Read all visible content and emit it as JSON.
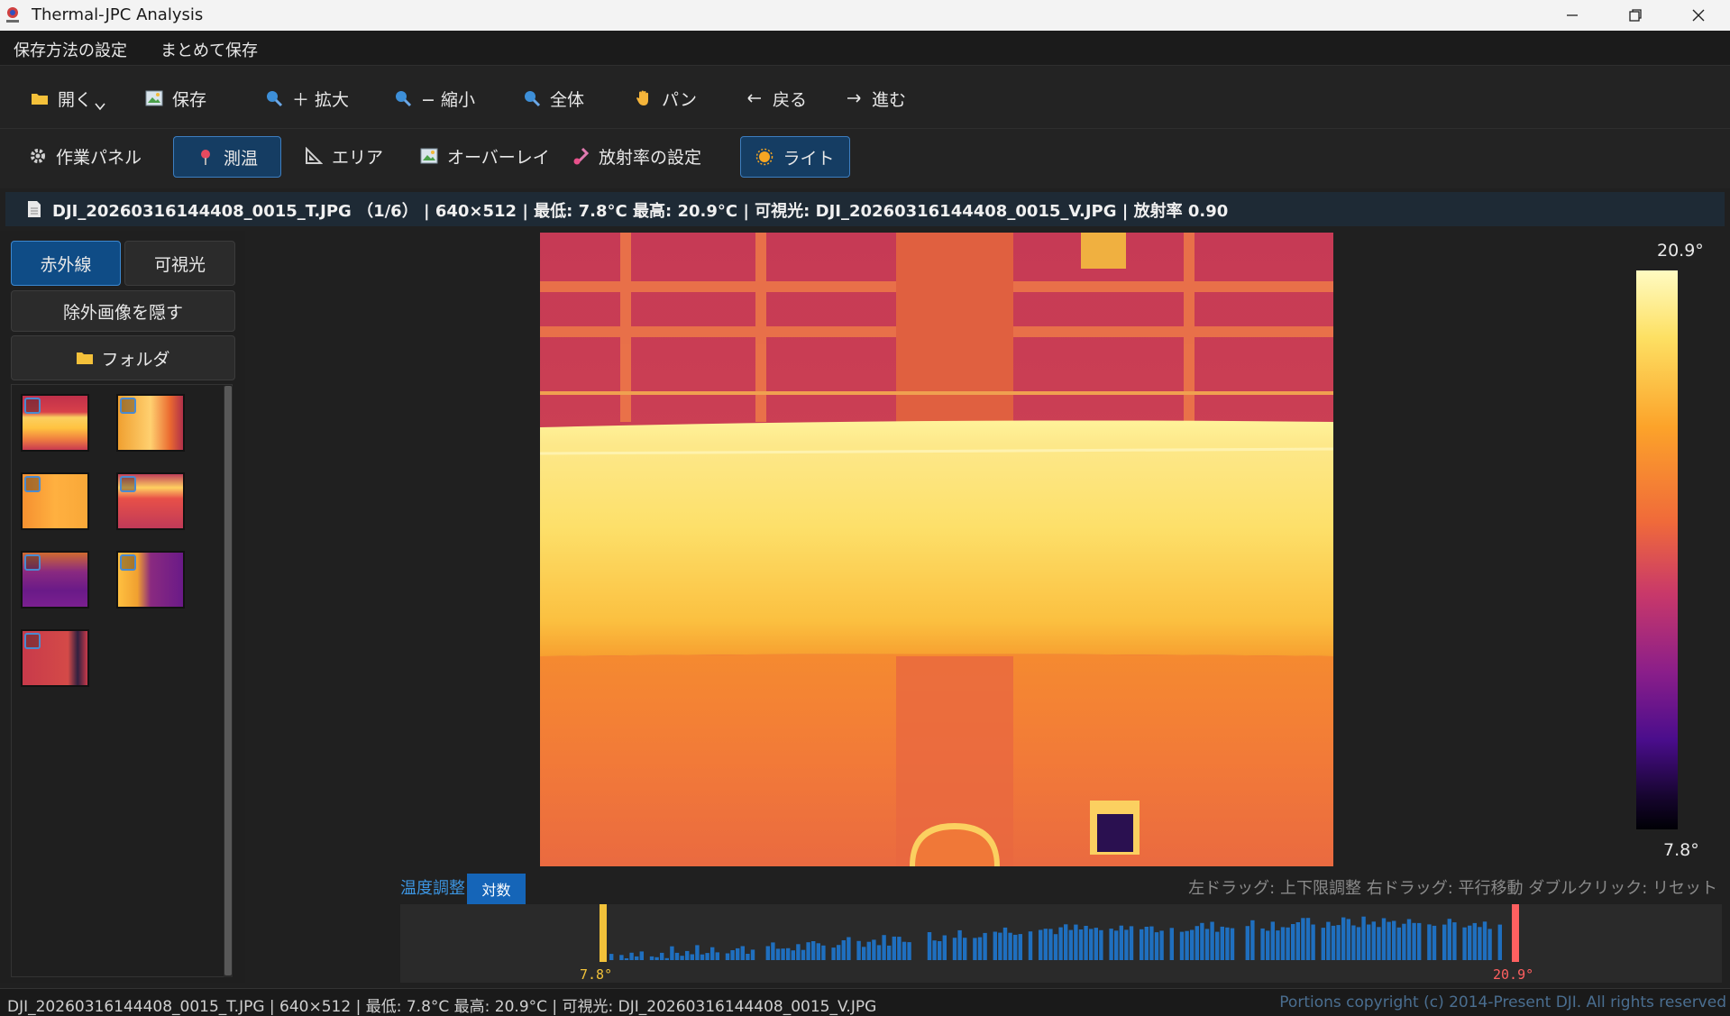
{
  "window": {
    "title": "Thermal-JPC Analysis",
    "controls": [
      "minimize",
      "restore",
      "close"
    ]
  },
  "menu": {
    "items": [
      "保存方法の設定",
      "まとめて保存"
    ]
  },
  "toolbar1": {
    "buttons": [
      {
        "label": "開く",
        "icon": "folder-icon",
        "dropdown": true
      },
      {
        "label": "保存",
        "icon": "image-save-icon"
      },
      {
        "label": "＋ 拡大",
        "icon": "zoom-in-icon"
      },
      {
        "label": "− 縮小",
        "icon": "zoom-out-icon"
      },
      {
        "label": "全体",
        "icon": "fit-icon"
      },
      {
        "label": "パン",
        "icon": "hand-icon"
      },
      {
        "label": "戻る",
        "icon": "back-icon"
      },
      {
        "label": "進む",
        "icon": "forward-icon"
      }
    ]
  },
  "toolbar2": {
    "buttons": [
      {
        "label": "作業パネル",
        "icon": "gear-icon",
        "active": false
      },
      {
        "label": "測温",
        "icon": "pin-icon",
        "active": true
      },
      {
        "label": "エリア",
        "icon": "triangle-ruler-icon",
        "active": false
      },
      {
        "label": "オーバーレイ",
        "icon": "image-overlay-icon",
        "active": false
      },
      {
        "label": "放射率の設定",
        "icon": "thermometer-icon",
        "active": false
      },
      {
        "label": "ライト",
        "icon": "sun-icon",
        "active": true
      }
    ]
  },
  "info": {
    "text": "DJI_20260316144408_0015_T.JPG （1/6） | 640×512 | 最低: 7.8°C  最高: 20.9°C | 可視光: DJI_20260316144408_0015_V.JPG | 放射率 0.90"
  },
  "left_panel": {
    "tab_infrared": "赤外線",
    "tab_visible": "可視光",
    "hide_excluded": "除外画像を隠す",
    "folder": "フォルダ",
    "thumbnail_count": 7
  },
  "scale": {
    "max": "20.9°",
    "min": "7.8°"
  },
  "temp_adjust": {
    "label": "温度調整",
    "log_button": "対数",
    "hint": "左ドラッグ: 上下限調整  右ドラッグ: 平行移動  ダブルクリック: リセット",
    "low": "7.8°",
    "high": "20.9°"
  },
  "status": {
    "text": "DJI_20260316144408_0015_T.JPG  |  640×512  |  最低: 7.8°C  最高: 20.9°C  |  可視光: DJI_20260316144408_0015_V.JPG",
    "copyright": "Portions copyright (c) 2014-Present DJI. All rights reserved"
  },
  "colors": {
    "accent": "#1565b8",
    "active_button": "#153d63",
    "histogram_bar": "#1f6fbf",
    "low_marker": "#f2c23a",
    "high_marker": "#ff6060"
  }
}
